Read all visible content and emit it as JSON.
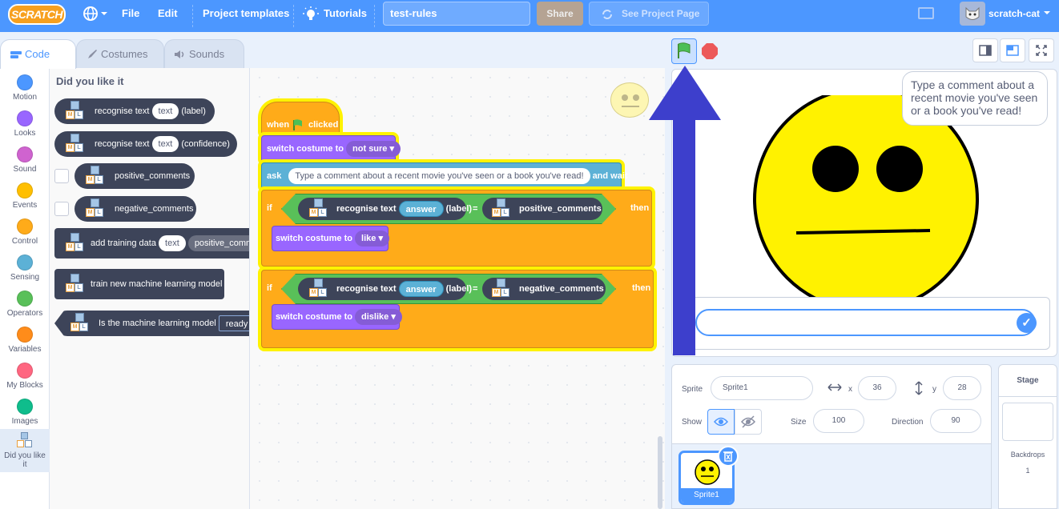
{
  "menubar": {
    "logo_text": "SCRATCH",
    "file": "File",
    "edit": "Edit",
    "project_templates": "Project templates",
    "tutorials": "Tutorials",
    "project_title": "test-rules",
    "share": "Share",
    "see_project_page": "See Project Page",
    "username": "scratch-cat"
  },
  "tabs": {
    "code": "Code",
    "costumes": "Costumes",
    "sounds": "Sounds"
  },
  "categories": [
    {
      "label": "Motion",
      "color": "#4c97ff"
    },
    {
      "label": "Looks",
      "color": "#9966ff"
    },
    {
      "label": "Sound",
      "color": "#cf63cf"
    },
    {
      "label": "Events",
      "color": "#ffbf00"
    },
    {
      "label": "Control",
      "color": "#ffab19"
    },
    {
      "label": "Sensing",
      "color": "#5cb1d6"
    },
    {
      "label": "Operators",
      "color": "#59c059"
    },
    {
      "label": "Variables",
      "color": "#ff8c1a"
    },
    {
      "label": "My Blocks",
      "color": "#ff6680"
    },
    {
      "label": "Images",
      "color": "#0fbd8c"
    },
    {
      "label": "Did you like it",
      "color": ""
    }
  ],
  "flyout": {
    "title": "Did you like it",
    "recognise_label": "recognise text",
    "text_arg": "text",
    "label_suffix": "(label)",
    "confidence_suffix": "(confidence)",
    "positive": "positive_comments",
    "negative": "negative_comments",
    "add_training": "add training data",
    "add_training_arg": "positive_comm",
    "train_model": "train new machine learning model",
    "is_model": "Is the machine learning model",
    "is_model_arg": "ready"
  },
  "script": {
    "when": "when",
    "clicked": "clicked",
    "switch_costume": "switch costume to",
    "costume_not_sure": "not sure",
    "ask": "ask",
    "ask_text": "Type a comment about a recent movie you've seen or a book you've read!",
    "and_wait": "and wait",
    "if": "if",
    "then": "then",
    "recognise": "recognise text",
    "answer": "answer",
    "label": "(label)",
    "equals": "=",
    "positive": "positive_comments",
    "negative": "negative_comments",
    "costume_like": "like",
    "costume_dislike": "dislike"
  },
  "stage": {
    "speech": "Type a comment about a recent movie you've seen or a book you've read!"
  },
  "sprite_info": {
    "sprite_label": "Sprite",
    "sprite_name": "Sprite1",
    "x_label": "x",
    "x": "36",
    "y_label": "y",
    "y": "28",
    "show_label": "Show",
    "size_label": "Size",
    "size": "100",
    "direction_label": "Direction",
    "direction": "90"
  },
  "sprite_list": {
    "sprite_name": "Sprite1"
  },
  "stage_pane": {
    "title": "Stage",
    "backdrops_label": "Backdrops",
    "backdrops_count": "1"
  },
  "colors": {
    "menubar": "#4c97ff",
    "arrow": "#3d3fcc",
    "sprite_face": "#fff200"
  }
}
